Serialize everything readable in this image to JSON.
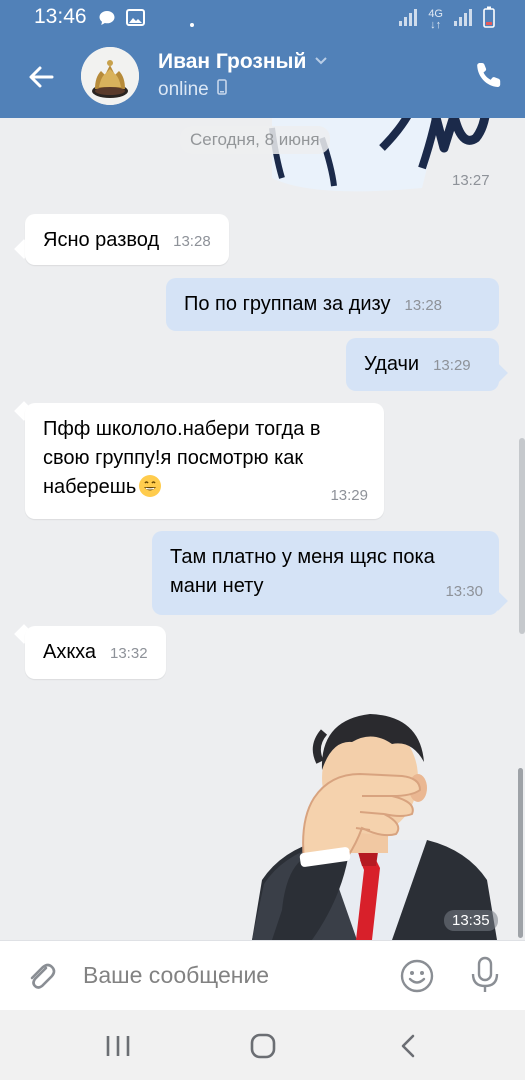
{
  "status_bar": {
    "time": "13:46",
    "network": "4G",
    "battery_icon": "battery-icon"
  },
  "header": {
    "contact_name": "Иван Грозный",
    "presence": "online"
  },
  "chat": {
    "date_label": "Сегодня, 8 июня",
    "top_sticker_time": "13:27",
    "messages": [
      {
        "direction": "in",
        "text": "Ясно развод",
        "time": "13:28"
      },
      {
        "direction": "out",
        "text": "По по группам за дизу",
        "time": "13:28"
      },
      {
        "direction": "out",
        "text": "Удачи",
        "time": "13:29"
      },
      {
        "direction": "in",
        "text_line1": "Пфф школоло.набери тогда в",
        "text_line2": "свою группу!я посмотрю как",
        "text_line3": "наберешь",
        "emoji": "😄",
        "time": "13:29"
      },
      {
        "direction": "out",
        "text_line1": "Там платно у меня щяс пока",
        "text_line2": "мани нету",
        "time": "13:30"
      },
      {
        "direction": "in",
        "text": "Ахкха",
        "time": "13:32"
      }
    ],
    "sticker_time": "13:35",
    "sticker_icon": "facepalm-sticker"
  },
  "composer": {
    "placeholder": "Ваше сообщение"
  },
  "colors": {
    "header": "#5181b8",
    "background": "#edeef0",
    "outgoing": "#d5e3f6",
    "incoming": "#ffffff"
  }
}
